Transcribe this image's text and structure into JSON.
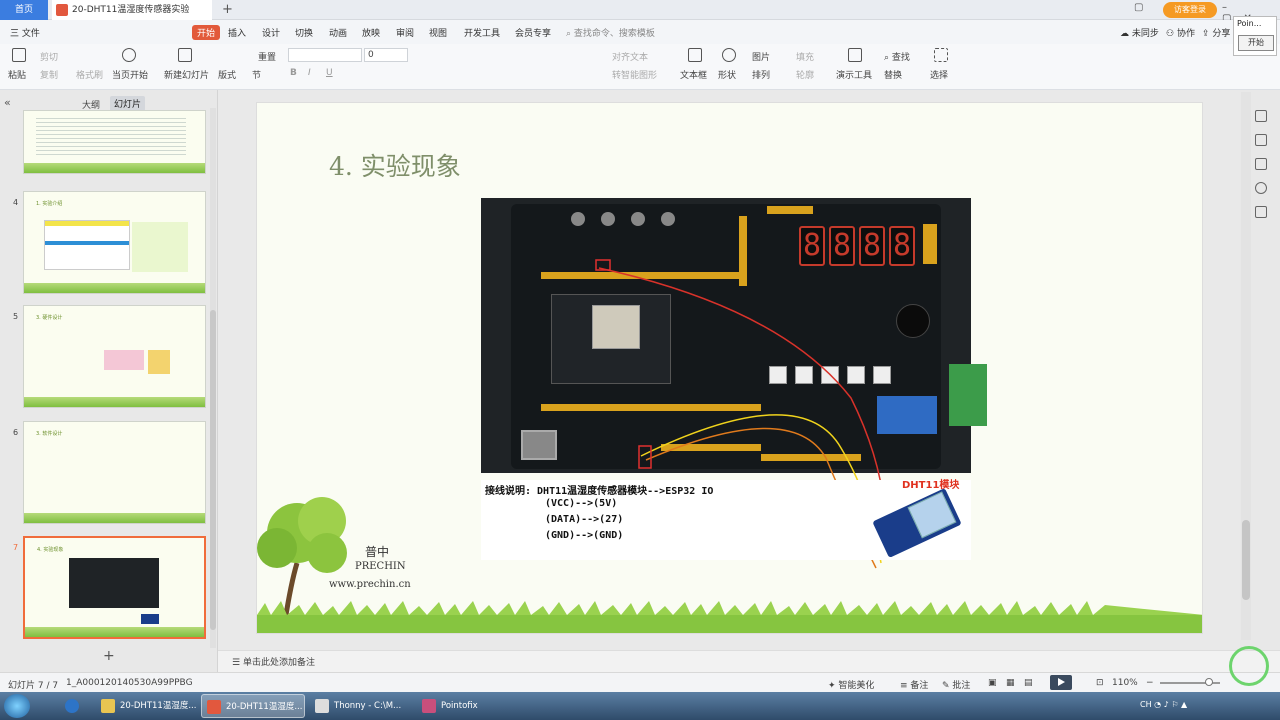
{
  "titlebar": {
    "home_tab": "首页",
    "doc_tab": "20-DHT11温湿度传感器实验",
    "new_tab_symbol": "+",
    "guest_button": "访客登录"
  },
  "ribbon_tabs": {
    "file": "三 文件",
    "start": "开始",
    "insert": "插入",
    "design": "设计",
    "transition": "切换",
    "animation": "动画",
    "slideshow": "放映",
    "review": "审阅",
    "view": "视图",
    "developer": "开发工具",
    "member": "会员专享",
    "search_placeholder": "查找命令、搜索模板",
    "unsynced": "未同步",
    "collab": "协作",
    "share": "分享"
  },
  "toolbar": {
    "paste": "粘贴",
    "cut": "剪切",
    "copy": "复制",
    "format_painter": "格式刷",
    "from_current": "当页开始",
    "new_slide": "新建幻灯片",
    "layout": "版式",
    "section": "节",
    "reset": "重置",
    "font_size": "0",
    "align": "对齐文本",
    "to_smartart": "转智能图形",
    "textbox": "文本框",
    "shape": "形状",
    "picture": "图片",
    "fill": "填充",
    "arrange": "排列",
    "outline": "轮廓",
    "presenter_tools": "演示工具",
    "find": "查找",
    "replace": "替换",
    "select": "选择"
  },
  "point_panel": {
    "title": "Poin...",
    "button": "开始"
  },
  "left_panel": {
    "outline_tab": "大纲",
    "slides_tab": "幻灯片",
    "thumbnails": [
      {
        "num": "",
        "title": ""
      },
      {
        "num": "4",
        "title": "1. 实验介绍"
      },
      {
        "num": "5",
        "title": "3. 硬件设计"
      },
      {
        "num": "6",
        "title": "3. 软件设计"
      },
      {
        "num": "7",
        "title": "4. 实验现象"
      }
    ],
    "add_symbol": "+"
  },
  "slide": {
    "title": "4. 实验现象",
    "dht_label": "DHT11模块",
    "wiring_lines": [
      "接线说明: DHT11温湿度传感器模块-->ESP32 IO",
      "(VCC)-->(5V)",
      "(DATA)-->(27)",
      "(GND)-->(GND)"
    ],
    "digits": [
      "8",
      "8",
      "8",
      "8"
    ],
    "logo_cn": "普中",
    "logo_en": "PRECHIN",
    "logo_url": "www.prechin.cn"
  },
  "notes": {
    "placeholder": "单击此处添加备注"
  },
  "status": {
    "slide_counter": "幻灯片 7 / 7",
    "file_id": "1_A000120140530A99PPBG",
    "beautify": "智能美化",
    "notes_btn": "备注",
    "comment_btn": "批注",
    "zoom": "110%"
  },
  "taskbar": {
    "items": [
      {
        "label": "20-DHT11温湿度..."
      },
      {
        "label": "20-DHT11温湿度..."
      },
      {
        "label": "Thonny  -  C:\\M..."
      },
      {
        "label": "Pointofix"
      }
    ],
    "tray": "CH"
  },
  "colors": {
    "accent": "#3b7de0",
    "ribbon_start": "#e25a3b",
    "selected_thumb": "#f06c3b",
    "slide_title": "#7f8f6a",
    "dht_label": "#e0311f"
  }
}
